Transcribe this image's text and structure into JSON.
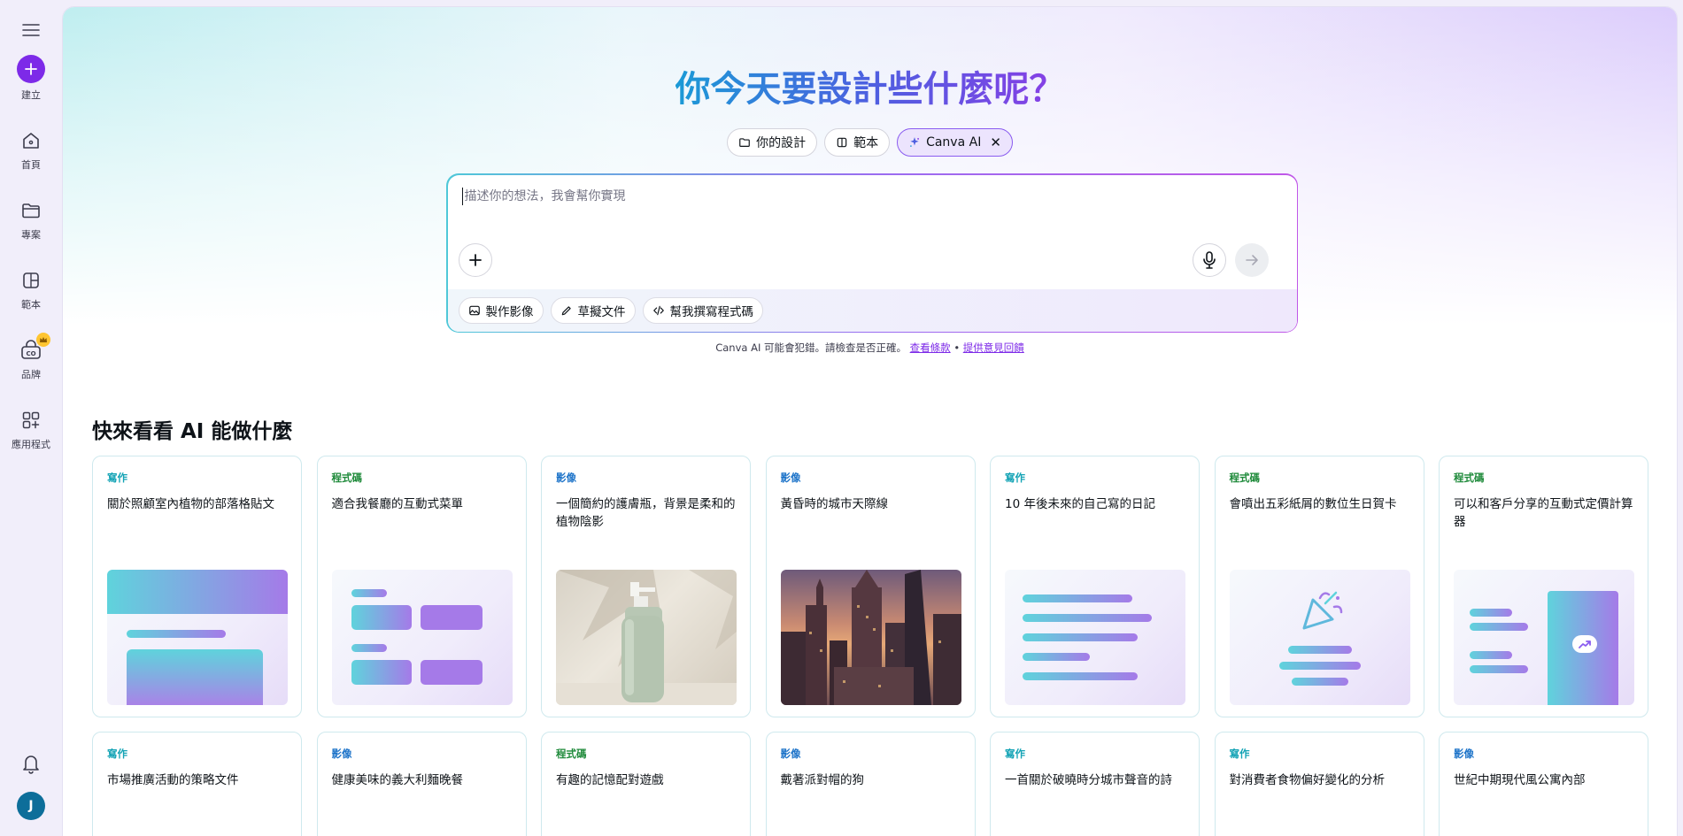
{
  "sidebar": {
    "create_label": "建立",
    "items": [
      {
        "label": "首頁",
        "icon": "home-icon"
      },
      {
        "label": "專案",
        "icon": "folder-icon"
      },
      {
        "label": "範本",
        "icon": "template-icon"
      },
      {
        "label": "品牌",
        "icon": "brand-icon"
      },
      {
        "label": "應用程式",
        "icon": "apps-icon"
      }
    ],
    "avatar_initial": "J"
  },
  "hero": {
    "title": "你今天要設計些什麼呢？",
    "chips": [
      {
        "label": "你的設計",
        "icon": "folder-icon"
      },
      {
        "label": "範本",
        "icon": "template-icon"
      },
      {
        "label": "Canva AI",
        "icon": "sparkle-icon",
        "active": true
      }
    ]
  },
  "prompt": {
    "placeholder": "描述你的想法，我會幫你實現",
    "actions": [
      {
        "label": "製作影像",
        "icon": "image-icon"
      },
      {
        "label": "草擬文件",
        "icon": "pen-icon"
      },
      {
        "label": "幫我撰寫程式碼",
        "icon": "code-icon"
      }
    ]
  },
  "disclaimer": {
    "text": "Canva AI 可能會犯錯。請檢查是否正確。",
    "terms_link": "查看條款",
    "separator": "•",
    "feedback_link": "提供意見回饋"
  },
  "section": {
    "title": "快來看看 AI 能做什麼"
  },
  "cards": [
    {
      "category": "寫作",
      "type": "write",
      "title": "關於照顧室內植物的部落格貼文"
    },
    {
      "category": "程式碼",
      "type": "code",
      "title": "適合我餐廳的互動式菜單"
    },
    {
      "category": "影像",
      "type": "image",
      "title": "一個簡約的護膚瓶，背景是柔和的植物陰影"
    },
    {
      "category": "影像",
      "type": "image",
      "title": "黃昏時的城市天際線"
    },
    {
      "category": "寫作",
      "type": "write",
      "title": "10 年後未來的自己寫的日記"
    },
    {
      "category": "程式碼",
      "type": "code",
      "title": "會噴出五彩紙屑的數位生日賀卡"
    },
    {
      "category": "程式碼",
      "type": "code",
      "title": "可以和客戶分享的互動式定價計算器"
    },
    {
      "category": "寫作",
      "type": "write",
      "title": "市場推廣活動的策略文件"
    },
    {
      "category": "影像",
      "type": "image",
      "title": "健康美味的義大利麵晚餐"
    },
    {
      "category": "程式碼",
      "type": "code",
      "title": "有趣的記憶配對遊戲"
    },
    {
      "category": "影像",
      "type": "image",
      "title": "戴著派對帽的狗"
    },
    {
      "category": "寫作",
      "type": "write",
      "title": "一首關於破曉時分城市聲音的詩"
    },
    {
      "category": "寫作",
      "type": "write",
      "title": "對消費者食物偏好變化的分析"
    },
    {
      "category": "影像",
      "type": "image",
      "title": "世紀中期現代風公寓內部"
    }
  ],
  "colors": {
    "accent": "#7d2ae8",
    "write": "#13a3b5",
    "code": "#1e8a3a",
    "image": "#1e74c9"
  }
}
